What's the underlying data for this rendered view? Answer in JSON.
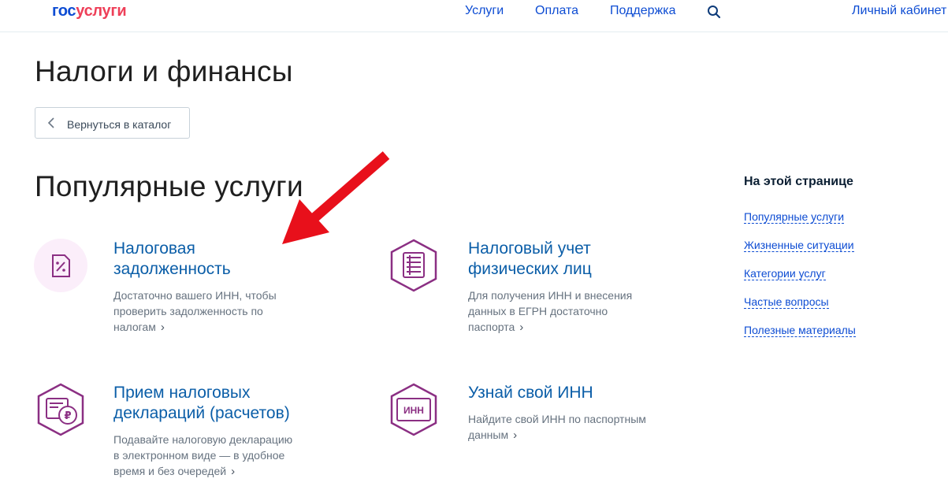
{
  "header": {
    "logo_part1": "гос",
    "logo_part2": "услуги",
    "nav": [
      "Услуги",
      "Оплата",
      "Поддержка"
    ],
    "account": "Личный кабинет"
  },
  "page": {
    "title": "Налоги и финансы",
    "back_button": "Вернуться в каталог",
    "section_title": "Популярные услуги"
  },
  "cards": [
    {
      "icon": "tax-debt-icon",
      "title_line1": "Налоговая",
      "title_line2": "задолженность",
      "desc_line1": "Достаточно вашего ИНН, чтобы",
      "desc_line2": "проверить задолженность по",
      "desc_line3": "налогам"
    },
    {
      "icon": "abacus-icon",
      "title_line1": "Налоговый учет",
      "title_line2": "физических лиц",
      "desc_line1": "Для получения ИНН и внесения",
      "desc_line2": "данных в ЕГРН достаточно",
      "desc_line3": "паспорта"
    },
    {
      "icon": "ruble-declaration-icon",
      "title_line1": "Прием налоговых",
      "title_line2": "деклараций (расчетов)",
      "desc_line1": "Подавайте налоговую декларацию",
      "desc_line2": "в электронном виде — в удобное",
      "desc_line3": "время и без очередей"
    },
    {
      "icon": "inn-card-icon",
      "icon_text": "ИНН",
      "title_line1": "Узнай свой ИНН",
      "desc_line1": "Найдите свой ИНН по паспортным",
      "desc_line2": "данным"
    }
  ],
  "toc": {
    "title": "На этой странице",
    "links": [
      "Популярные услуги",
      "Жизненные ситуации",
      "Категории услуг",
      "Частые вопросы",
      "Полезные материалы"
    ]
  },
  "colors": {
    "brand_blue": "#0d4cd3",
    "brand_red": "#ee3f58",
    "icon_purple": "#8b2f83",
    "annotation_red": "#e8101b"
  }
}
